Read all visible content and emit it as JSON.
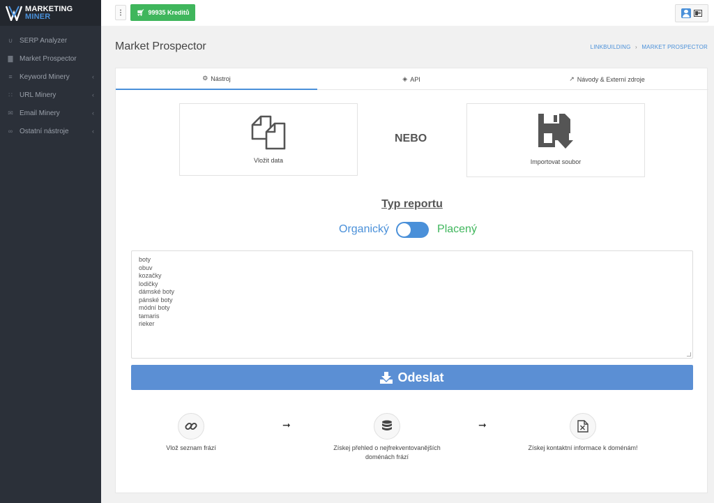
{
  "app": {
    "logo_line1": "MARKETING",
    "logo_line2": "MINER",
    "accent": "#4a90d9",
    "success": "#3fb65c"
  },
  "sidebar": {
    "items": [
      {
        "label": "SERP Analyzer",
        "icon": "magnet-icon",
        "has_children": false
      },
      {
        "label": "Market Prospector",
        "icon": "bar-chart-icon",
        "has_children": false
      },
      {
        "label": "Keyword Minery",
        "icon": "sort-icon",
        "has_children": true
      },
      {
        "label": "URL Minery",
        "icon": "sitemap-icon",
        "has_children": true
      },
      {
        "label": "Email Minery",
        "icon": "envelope-icon",
        "has_children": true
      },
      {
        "label": "Ostatní nástroje",
        "icon": "link-icon",
        "has_children": true
      }
    ]
  },
  "topbar": {
    "credits_label": "99935 Kreditů"
  },
  "header": {
    "title": "Market Prospector",
    "breadcrumb": [
      "LINKBUILDING",
      "MARKET PROSPECTOR"
    ]
  },
  "tabs": [
    {
      "label": "Nástroj",
      "icon": "cogs-icon",
      "active": true
    },
    {
      "label": "API",
      "icon": "cube-icon",
      "active": false
    },
    {
      "label": "Návody & Externí zdroje",
      "icon": "external-link-icon",
      "active": false
    }
  ],
  "input_options": {
    "paste_label": "Vložit data",
    "or_label": "NEBO",
    "import_label": "Importovat soubor"
  },
  "report": {
    "title": "Typ reportu",
    "option_organic": "Organický",
    "option_paid": "Placený",
    "selected": "Placený"
  },
  "phrases": [
    "boty",
    "obuv",
    "kozačky",
    "lodičky",
    "dámské boty",
    "pánské boty",
    "módní boty",
    "tamaris",
    "rieker"
  ],
  "submit_label": "Odeslat",
  "steps": [
    {
      "text": "Vlož seznam frází",
      "icon": "link-icon"
    },
    {
      "text": "Získej přehled o nejfrekventovanějších doménách frází",
      "icon": "database-icon"
    },
    {
      "text": "Získej kontaktní informace k doménám!",
      "icon": "excel-file-icon"
    }
  ]
}
